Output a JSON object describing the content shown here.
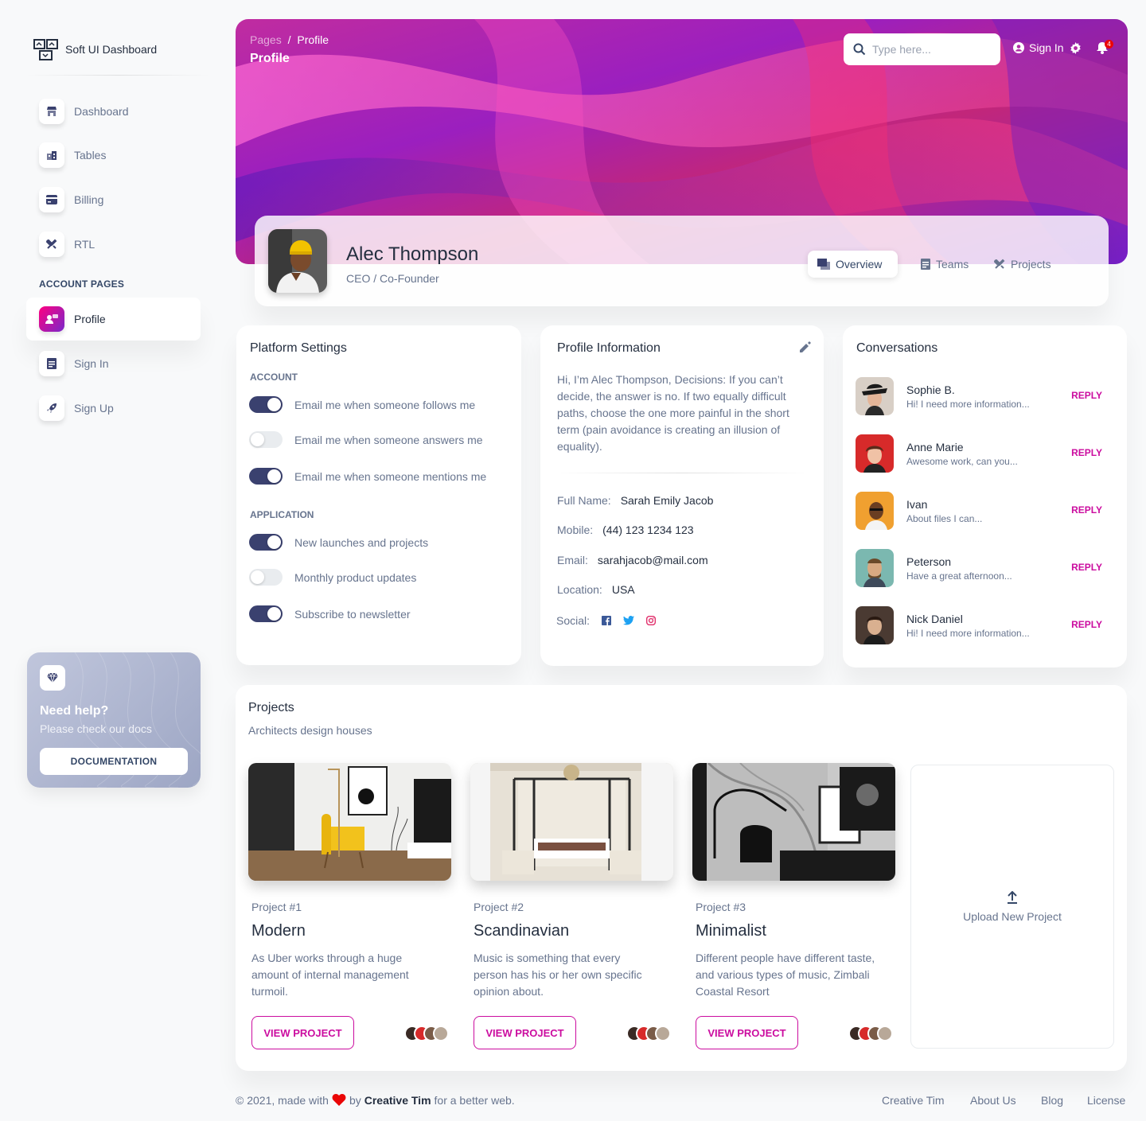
{
  "sidebar": {
    "brand": "Soft UI Dashboard",
    "items": [
      {
        "label": "Dashboard"
      },
      {
        "label": "Tables"
      },
      {
        "label": "Billing"
      },
      {
        "label": "RTL"
      },
      {
        "label": "Profile"
      },
      {
        "label": "Sign In"
      },
      {
        "label": "Sign Up"
      }
    ],
    "section_title": "ACCOUNT PAGES",
    "active_item": "Profile",
    "help": {
      "title": "Need help?",
      "subtitle": "Please check our docs",
      "button": "DOCUMENTATION"
    }
  },
  "header": {
    "breadcrumb_parent": "Pages",
    "breadcrumb_sep": "/",
    "breadcrumb_current": "Profile",
    "title": "Profile",
    "search_placeholder": "Type here...",
    "signin": "Sign In",
    "notification_count": "4"
  },
  "profile": {
    "name": "Alec Thompson",
    "role": "CEO / Co-Founder",
    "tabs": [
      {
        "label": "Overview"
      },
      {
        "label": "Teams"
      },
      {
        "label": "Projects"
      }
    ],
    "active_tab": "Overview"
  },
  "platform_settings": {
    "title": "Platform Settings",
    "account_label": "ACCOUNT",
    "application_label": "APPLICATION",
    "account": [
      {
        "label": "Email me when someone follows me",
        "on": true
      },
      {
        "label": "Email me when someone answers me",
        "on": false
      },
      {
        "label": "Email me when someone mentions me",
        "on": true
      }
    ],
    "application": [
      {
        "label": "New launches and projects",
        "on": true
      },
      {
        "label": "Monthly product updates",
        "on": false
      },
      {
        "label": "Subscribe to newsletter",
        "on": true
      }
    ]
  },
  "profile_info": {
    "title": "Profile Information",
    "bio": "Hi, I’m Alec Thompson, Decisions: If you can’t decide, the answer is no. If two equally difficult paths, choose the one more painful in the short term (pain avoidance is creating an illusion of equality).",
    "full_name_label": "Full Name:",
    "full_name": "Sarah Emily Jacob",
    "mobile_label": "Mobile:",
    "mobile": "(44) 123 1234 123",
    "email_label": "Email:",
    "email": "sarahjacob@mail.com",
    "location_label": "Location:",
    "location": "USA",
    "social_label": "Social:",
    "social_icons": [
      "facebook-icon",
      "twitter-icon",
      "instagram-icon"
    ]
  },
  "conversations": {
    "title": "Conversations",
    "reply_label": "REPLY",
    "items": [
      {
        "name": "Sophie B.",
        "message": "Hi! I need more information..."
      },
      {
        "name": "Anne Marie",
        "message": "Awesome work, can you..."
      },
      {
        "name": "Ivan",
        "message": "About files I can..."
      },
      {
        "name": "Peterson",
        "message": "Have a great afternoon..."
      },
      {
        "name": "Nick Daniel",
        "message": "Hi! I need more information..."
      }
    ]
  },
  "projects": {
    "title": "Projects",
    "subtitle": "Architects design houses",
    "button_label": "VIEW PROJECT",
    "upload_label": "Upload New Project",
    "items": [
      {
        "number": "Project #1",
        "name": "Modern",
        "description": "As Uber works through a huge amount of internal management turmoil."
      },
      {
        "number": "Project #2",
        "name": "Scandinavian",
        "description": "Music is something that every person has his or her own specific opinion about."
      },
      {
        "number": "Project #3",
        "name": "Minimalist",
        "description": "Different people have different taste, and various types of music, Zimbali Coastal Resort"
      }
    ]
  },
  "footer": {
    "prefix": "© 2021, made with",
    "by": "by",
    "author": "Creative Tim",
    "suffix": "for a better web.",
    "links": [
      {
        "label": "Creative Tim"
      },
      {
        "label": "About Us"
      },
      {
        "label": "Blog"
      },
      {
        "label": "License"
      }
    ]
  },
  "colors": {
    "accent": "#cb0c9f",
    "dark": "#344767",
    "toggle_on": "#3a416f",
    "muted": "#67748e"
  }
}
